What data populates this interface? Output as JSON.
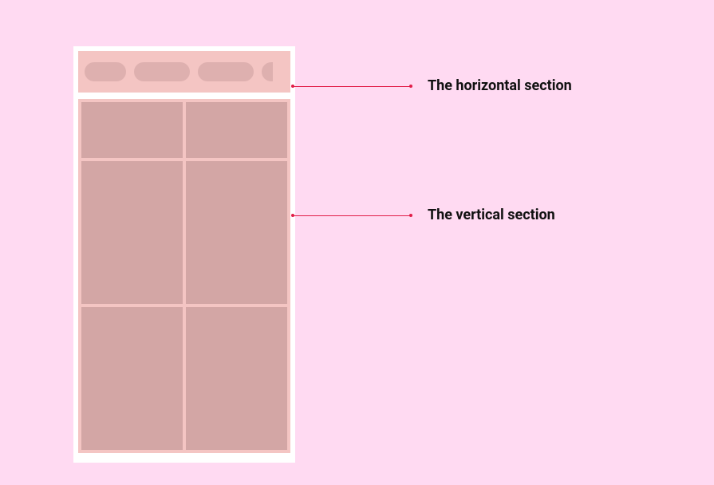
{
  "annotations": {
    "horizontal": "The horizontal section",
    "vertical": "The vertical section"
  }
}
